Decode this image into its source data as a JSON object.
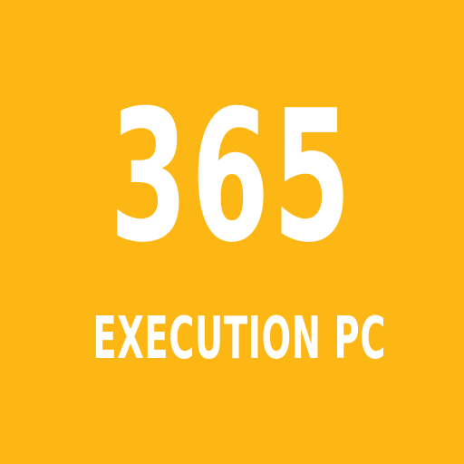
{
  "logo": {
    "number": "365",
    "subtitle": "EXECUTION PC"
  },
  "colors": {
    "background": "#FDB714",
    "text": "#FFFFFF"
  }
}
